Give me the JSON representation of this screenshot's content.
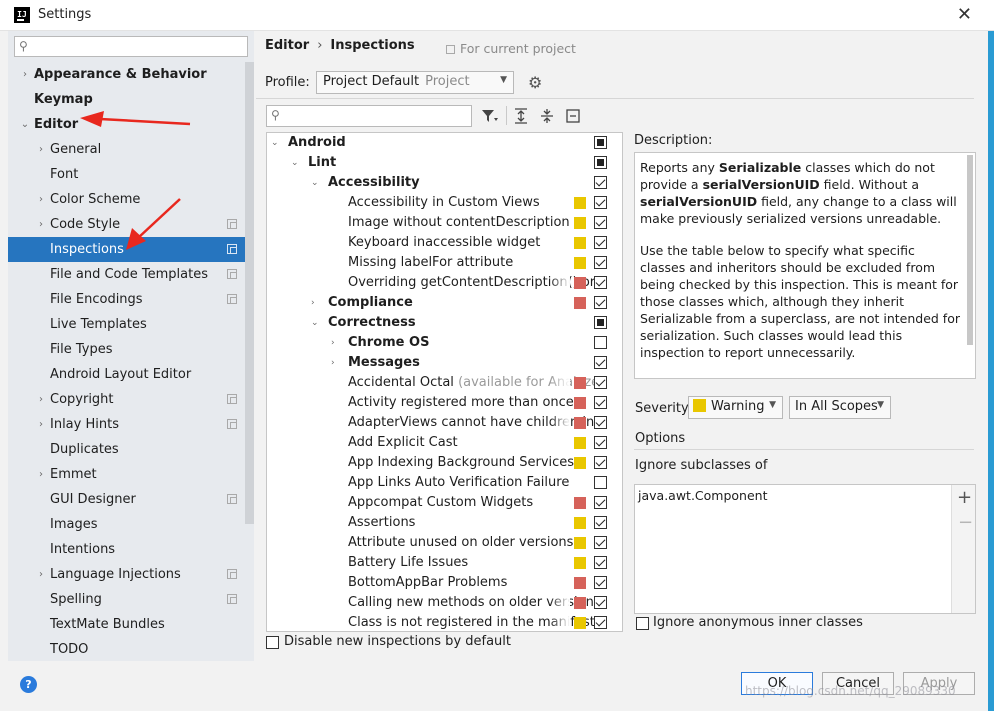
{
  "window": {
    "title": "Settings",
    "icon_name": "intellij-icon",
    "close_glyph": "✕"
  },
  "sidebar": {
    "search_placeholder": "",
    "items": [
      {
        "label": "Appearance & Behavior",
        "bold": true,
        "level": 0,
        "arrow": "›",
        "proj": false
      },
      {
        "label": "Keymap",
        "bold": true,
        "level": 0,
        "arrow": "",
        "proj": false
      },
      {
        "label": "Editor",
        "bold": true,
        "level": 0,
        "arrow": "⌄",
        "proj": false
      },
      {
        "label": "General",
        "bold": false,
        "level": 1,
        "arrow": "›",
        "proj": false
      },
      {
        "label": "Font",
        "bold": false,
        "level": 1,
        "arrow": "",
        "proj": false
      },
      {
        "label": "Color Scheme",
        "bold": false,
        "level": 1,
        "arrow": "›",
        "proj": false
      },
      {
        "label": "Code Style",
        "bold": false,
        "level": 1,
        "arrow": "›",
        "proj": true
      },
      {
        "label": "Inspections",
        "bold": false,
        "level": 1,
        "arrow": "",
        "proj": true,
        "selected": true
      },
      {
        "label": "File and Code Templates",
        "bold": false,
        "level": 1,
        "arrow": "",
        "proj": true
      },
      {
        "label": "File Encodings",
        "bold": false,
        "level": 1,
        "arrow": "",
        "proj": true
      },
      {
        "label": "Live Templates",
        "bold": false,
        "level": 1,
        "arrow": "",
        "proj": false
      },
      {
        "label": "File Types",
        "bold": false,
        "level": 1,
        "arrow": "",
        "proj": false
      },
      {
        "label": "Android Layout Editor",
        "bold": false,
        "level": 1,
        "arrow": "",
        "proj": false
      },
      {
        "label": "Copyright",
        "bold": false,
        "level": 1,
        "arrow": "›",
        "proj": true
      },
      {
        "label": "Inlay Hints",
        "bold": false,
        "level": 1,
        "arrow": "›",
        "proj": true
      },
      {
        "label": "Duplicates",
        "bold": false,
        "level": 1,
        "arrow": "",
        "proj": false
      },
      {
        "label": "Emmet",
        "bold": false,
        "level": 1,
        "arrow": "›",
        "proj": false
      },
      {
        "label": "GUI Designer",
        "bold": false,
        "level": 1,
        "arrow": "",
        "proj": true
      },
      {
        "label": "Images",
        "bold": false,
        "level": 1,
        "arrow": "",
        "proj": false
      },
      {
        "label": "Intentions",
        "bold": false,
        "level": 1,
        "arrow": "",
        "proj": false
      },
      {
        "label": "Language Injections",
        "bold": false,
        "level": 1,
        "arrow": "›",
        "proj": true
      },
      {
        "label": "Spelling",
        "bold": false,
        "level": 1,
        "arrow": "",
        "proj": true
      },
      {
        "label": "TextMate Bundles",
        "bold": false,
        "level": 1,
        "arrow": "",
        "proj": false
      },
      {
        "label": "TODO",
        "bold": false,
        "level": 1,
        "arrow": "",
        "proj": false
      }
    ]
  },
  "header": {
    "breadcrumb": [
      "Editor",
      "Inspections"
    ],
    "breadcrumb_sep": "›",
    "for_project": "For current project"
  },
  "profile": {
    "label": "Profile:",
    "value": "Project Default",
    "sub": "Project"
  },
  "inspections": [
    {
      "label": "Android",
      "level": 0,
      "bold": true,
      "arrow": "⌄",
      "sev": "",
      "check": "part"
    },
    {
      "label": "Lint",
      "level": 1,
      "bold": true,
      "arrow": "⌄",
      "sev": "",
      "check": "part"
    },
    {
      "label": "Accessibility",
      "level": 2,
      "bold": true,
      "arrow": "⌄",
      "sev": "",
      "check": "on"
    },
    {
      "label": "Accessibility in Custom Views",
      "level": 3,
      "bold": false,
      "arrow": "",
      "sev": "y",
      "check": "on"
    },
    {
      "label": "Image without contentDescription",
      "level": 3,
      "bold": false,
      "arrow": "",
      "sev": "y",
      "check": "on"
    },
    {
      "label": "Keyboard inaccessible widget",
      "level": 3,
      "bold": false,
      "arrow": "",
      "sev": "y",
      "check": "on"
    },
    {
      "label": "Missing labelFor attribute",
      "level": 3,
      "bold": false,
      "arrow": "",
      "sev": "y",
      "check": "on"
    },
    {
      "label": "Overriding getContentDescription() or",
      "level": 3,
      "bold": false,
      "arrow": "",
      "sev": "r",
      "check": "on",
      "fade": true
    },
    {
      "label": "Compliance",
      "level": 2,
      "bold": true,
      "arrow": "›",
      "sev": "r",
      "check": "on"
    },
    {
      "label": "Correctness",
      "level": 2,
      "bold": true,
      "arrow": "⌄",
      "sev": "",
      "check": "part"
    },
    {
      "label": "Chrome OS",
      "level": 3,
      "bold": true,
      "arrow": "›",
      "sev": "",
      "check": "off"
    },
    {
      "label": "Messages",
      "level": 3,
      "bold": true,
      "arrow": "›",
      "sev": "",
      "check": "on"
    },
    {
      "label": "Accidental Octal",
      "hint": " (available for Analyze",
      "level": 3,
      "bold": false,
      "arrow": "",
      "sev": "r",
      "check": "on",
      "fade": true
    },
    {
      "label": "Activity registered more than once",
      "level": 3,
      "bold": false,
      "arrow": "",
      "sev": "r",
      "check": "on"
    },
    {
      "label": "AdapterViews cannot have children in",
      "level": 3,
      "bold": false,
      "arrow": "",
      "sev": "r",
      "check": "on",
      "fade": true
    },
    {
      "label": "Add Explicit Cast",
      "level": 3,
      "bold": false,
      "arrow": "",
      "sev": "y",
      "check": "on"
    },
    {
      "label": "App Indexing Background Services",
      "level": 3,
      "bold": false,
      "arrow": "",
      "sev": "y",
      "check": "on"
    },
    {
      "label": "App Links Auto Verification Failure",
      "level": 3,
      "bold": false,
      "arrow": "",
      "sev": "",
      "check": "off"
    },
    {
      "label": "Appcompat Custom Widgets",
      "level": 3,
      "bold": false,
      "arrow": "",
      "sev": "r",
      "check": "on"
    },
    {
      "label": "Assertions",
      "level": 3,
      "bold": false,
      "arrow": "",
      "sev": "y",
      "check": "on"
    },
    {
      "label": "Attribute unused on older versions",
      "level": 3,
      "bold": false,
      "arrow": "",
      "sev": "y",
      "check": "on"
    },
    {
      "label": "Battery Life Issues",
      "level": 3,
      "bold": false,
      "arrow": "",
      "sev": "y",
      "check": "on"
    },
    {
      "label": "BottomAppBar Problems",
      "level": 3,
      "bold": false,
      "arrow": "",
      "sev": "r",
      "check": "on"
    },
    {
      "label": "Calling new methods on older version",
      "level": 3,
      "bold": false,
      "arrow": "",
      "sev": "r",
      "check": "on",
      "fade": true
    },
    {
      "label": "Class is not registered in the manifest",
      "level": 3,
      "bold": false,
      "arrow": "",
      "sev": "y",
      "check": "on",
      "fade": true
    }
  ],
  "disable_new": "Disable new inspections by default",
  "description": {
    "label": "Description:",
    "p1_a": "Reports any ",
    "p1_b": "Serializable",
    "p1_c": " classes which do not provide a ",
    "p1_d": "serialVersionUID",
    "p1_e": " field. Without a ",
    "p1_f": "serialVersionUID",
    "p1_g": " field, any change to a class will make previously serialized versions unreadable.",
    "p2": "Use the table below to specify what specific classes and inheritors should be excluded from being checked by this inspection. This is meant for those classes which, although they inherit Serializable from a superclass, are not intended for serialization. Such classes would lead this inspection to report unnecessarily."
  },
  "severity": {
    "label": "Severity:",
    "value": "Warning",
    "color": "#e9c700",
    "scope": "In All Scopes"
  },
  "options": {
    "label": "Options",
    "ignore_label": "Ignore subclasses of",
    "ignore_items": [
      "java.awt.Component"
    ],
    "anon_label": "Ignore anonymous inner classes"
  },
  "buttons": {
    "ok": "OK",
    "cancel": "Cancel",
    "apply": "Apply"
  },
  "help_glyph": "?",
  "watermark": "https://blog.csdn.net/qq_29089330",
  "colors": {
    "selection": "#2675bf",
    "warning": "#e9c700",
    "error": "#d6625a",
    "accent": "#2a7bdc"
  }
}
